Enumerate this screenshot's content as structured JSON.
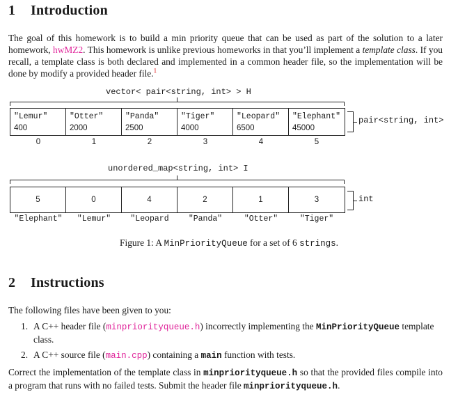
{
  "section1": {
    "number": "1",
    "title": "Introduction",
    "paragraph": {
      "t1": "The goal of this homework is to build a min priority queue that can be used as part of the solution to a later homework, ",
      "link": "hwMZ2",
      "t2": ". This homework is unlike previous homeworks in that you’ll implement a ",
      "em1": "template class",
      "t3": ". If you recall, a template class is both declared and implemented in a common header file, so the implementation will be done by modify a provided header file.",
      "footnote": "1"
    }
  },
  "figure": {
    "heap_label": "vector< pair<string, int> > H",
    "heap_cells": [
      {
        "key": "\"Lemur\"",
        "value": "400"
      },
      {
        "key": "\"Otter\"",
        "value": "2000"
      },
      {
        "key": "\"Panda\"",
        "value": "2500"
      },
      {
        "key": "\"Tiger\"",
        "value": "4000"
      },
      {
        "key": "\"Leopard\"",
        "value": "6500"
      },
      {
        "key": "\"Elephant\"",
        "value": "45000"
      }
    ],
    "heap_indices": [
      "0",
      "1",
      "2",
      "3",
      "4",
      "5"
    ],
    "heap_element_label": "pair<string, int>",
    "map_label": "unordered_map<string, int> I",
    "map_values": [
      "5",
      "0",
      "4",
      "2",
      "1",
      "3"
    ],
    "map_keys": [
      "\"Elephant\"",
      "\"Lemur\"",
      "\"Leopard",
      "\"Panda\"",
      "\"Otter\"",
      "\"Tiger\""
    ],
    "map_element_label": "int",
    "caption": {
      "prefix": "Figure 1: A ",
      "code": "MinPriorityQueue",
      "mid": " for a set of 6 ",
      "code2": "strings",
      "suffix": "."
    }
  },
  "section2": {
    "number": "2",
    "title": "Instructions",
    "intro": "The following files have been given to you:",
    "items": [
      {
        "num": "1.",
        "t1": "A C++ header file (",
        "file": "minpriorityqueue.h",
        "t2": ") incorrectly implementing the ",
        "code": "MinPriorityQueue",
        "t3": " template",
        "t4": "class."
      },
      {
        "num": "2.",
        "t1": "A C++ source file (",
        "file": "main.cpp",
        "t2": ") containing a ",
        "code": "main",
        "t3": " function with tests."
      }
    ],
    "closing": {
      "t1": "Correct the implementation of the template class in ",
      "code1": "minpriorityqueue.h",
      "t2": " so that the provided files compile into a program that runs with no failed tests. Submit the header file ",
      "code2": "minpriorityqueue.h",
      "t3": "."
    }
  },
  "colors": {
    "link": "#e0249a",
    "footnote": "#e02020",
    "text": "#1a1a1a"
  }
}
